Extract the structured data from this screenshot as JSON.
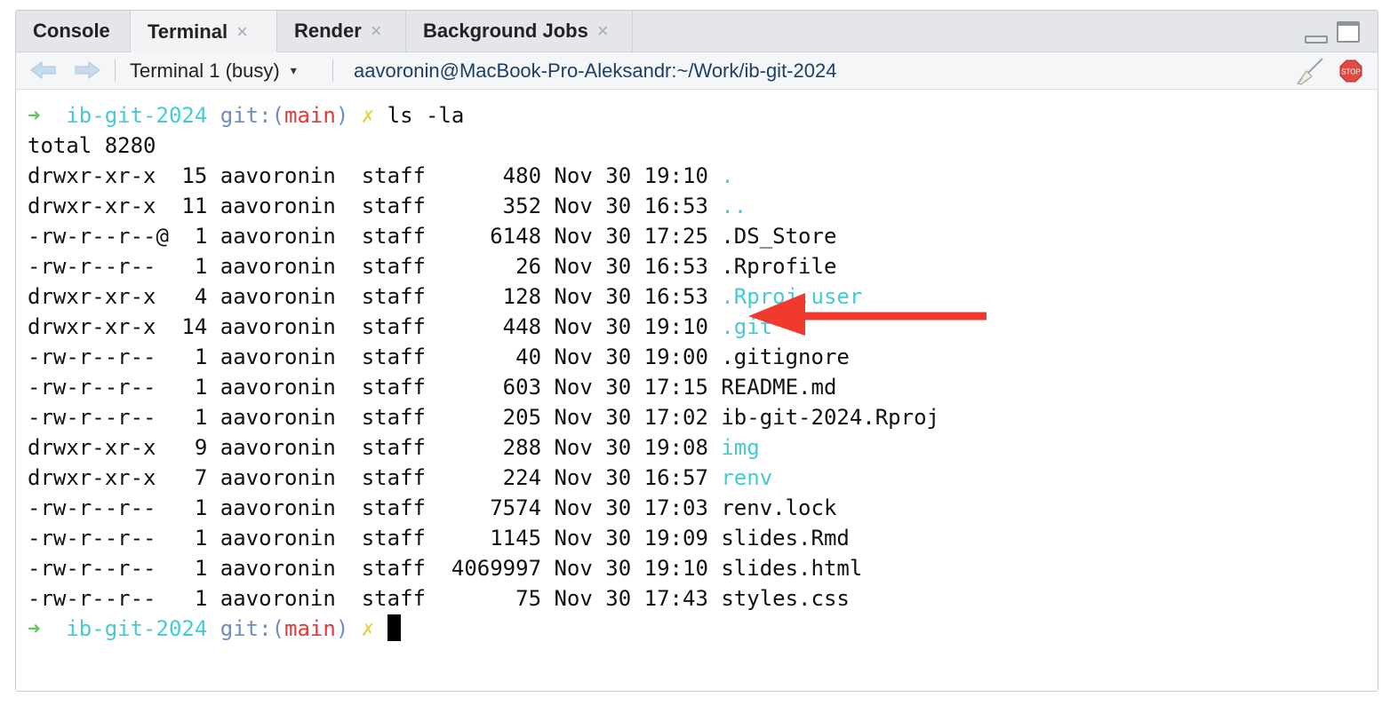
{
  "tabs": [
    {
      "label": "Console",
      "closable": false,
      "active": false
    },
    {
      "label": "Terminal",
      "closable": true,
      "active": true
    },
    {
      "label": "Render",
      "closable": true,
      "active": false
    },
    {
      "label": "Background Jobs",
      "closable": true,
      "active": false
    }
  ],
  "close_glyph": "×",
  "toolbar": {
    "back_icon": "arrow-left-icon",
    "forward_icon": "arrow-right-icon",
    "terminal_select": "Terminal 1 (busy)",
    "caret": "▾",
    "title": "aavoronin@MacBook-Pro-Aleksandr:~/Work/ib-git-2024",
    "clear_icon": "broom-icon",
    "stop_icon": "stop-icon",
    "stop_label": "STOP"
  },
  "prompt": {
    "arrow": "➜",
    "dir": "ib-git-2024",
    "git_open": "git:(",
    "branch": "main",
    "git_close": ")",
    "dirty": "✗"
  },
  "command": "ls -la",
  "total_line": "total 8280",
  "listing": [
    {
      "perms": "drwxr-xr-x ",
      "links": "15",
      "owner": "aavoronin",
      "group": "staff",
      "size": "480",
      "month": "Nov",
      "day": "30",
      "time": "19:10",
      "name": ".",
      "dir": true
    },
    {
      "perms": "drwxr-xr-x ",
      "links": "11",
      "owner": "aavoronin",
      "group": "staff",
      "size": "352",
      "month": "Nov",
      "day": "30",
      "time": "16:53",
      "name": "..",
      "dir": true
    },
    {
      "perms": "-rw-r--r--@",
      "links": "1",
      "owner": "aavoronin",
      "group": "staff",
      "size": "6148",
      "month": "Nov",
      "day": "30",
      "time": "17:25",
      "name": ".DS_Store",
      "dir": false
    },
    {
      "perms": "-rw-r--r-- ",
      "links": "1",
      "owner": "aavoronin",
      "group": "staff",
      "size": "26",
      "month": "Nov",
      "day": "30",
      "time": "16:53",
      "name": ".Rprofile",
      "dir": false
    },
    {
      "perms": "drwxr-xr-x ",
      "links": "4",
      "owner": "aavoronin",
      "group": "staff",
      "size": "128",
      "month": "Nov",
      "day": "30",
      "time": "16:53",
      "name": ".Rproj.user",
      "dir": true
    },
    {
      "perms": "drwxr-xr-x ",
      "links": "14",
      "owner": "aavoronin",
      "group": "staff",
      "size": "448",
      "month": "Nov",
      "day": "30",
      "time": "19:10",
      "name": ".git",
      "dir": true
    },
    {
      "perms": "-rw-r--r-- ",
      "links": "1",
      "owner": "aavoronin",
      "group": "staff",
      "size": "40",
      "month": "Nov",
      "day": "30",
      "time": "19:00",
      "name": ".gitignore",
      "dir": false
    },
    {
      "perms": "-rw-r--r-- ",
      "links": "1",
      "owner": "aavoronin",
      "group": "staff",
      "size": "603",
      "month": "Nov",
      "day": "30",
      "time": "17:15",
      "name": "README.md",
      "dir": false
    },
    {
      "perms": "-rw-r--r-- ",
      "links": "1",
      "owner": "aavoronin",
      "group": "staff",
      "size": "205",
      "month": "Nov",
      "day": "30",
      "time": "17:02",
      "name": "ib-git-2024.Rproj",
      "dir": false
    },
    {
      "perms": "drwxr-xr-x ",
      "links": "9",
      "owner": "aavoronin",
      "group": "staff",
      "size": "288",
      "month": "Nov",
      "day": "30",
      "time": "19:08",
      "name": "img",
      "dir": true
    },
    {
      "perms": "drwxr-xr-x ",
      "links": "7",
      "owner": "aavoronin",
      "group": "staff",
      "size": "224",
      "month": "Nov",
      "day": "30",
      "time": "16:57",
      "name": "renv",
      "dir": true
    },
    {
      "perms": "-rw-r--r-- ",
      "links": "1",
      "owner": "aavoronin",
      "group": "staff",
      "size": "7574",
      "month": "Nov",
      "day": "30",
      "time": "17:03",
      "name": "renv.lock",
      "dir": false
    },
    {
      "perms": "-rw-r--r-- ",
      "links": "1",
      "owner": "aavoronin",
      "group": "staff",
      "size": "1145",
      "month": "Nov",
      "day": "30",
      "time": "19:09",
      "name": "slides.Rmd",
      "dir": false
    },
    {
      "perms": "-rw-r--r-- ",
      "links": "1",
      "owner": "aavoronin",
      "group": "staff",
      "size": "4069997",
      "month": "Nov",
      "day": "30",
      "time": "19:10",
      "name": "slides.html",
      "dir": false
    },
    {
      "perms": "-rw-r--r-- ",
      "links": "1",
      "owner": "aavoronin",
      "group": "staff",
      "size": "75",
      "month": "Nov",
      "day": "30",
      "time": "17:43",
      "name": "styles.css",
      "dir": false
    }
  ],
  "annotation": {
    "target": ".git",
    "icon": "red-arrow-icon",
    "color": "#f03a2e"
  },
  "colors": {
    "prompt_arrow": "#5cc85c",
    "dir": "#44cbd6",
    "git": "#6c8fc0",
    "branch": "#e03a3a",
    "dirty": "#e8d24a"
  }
}
